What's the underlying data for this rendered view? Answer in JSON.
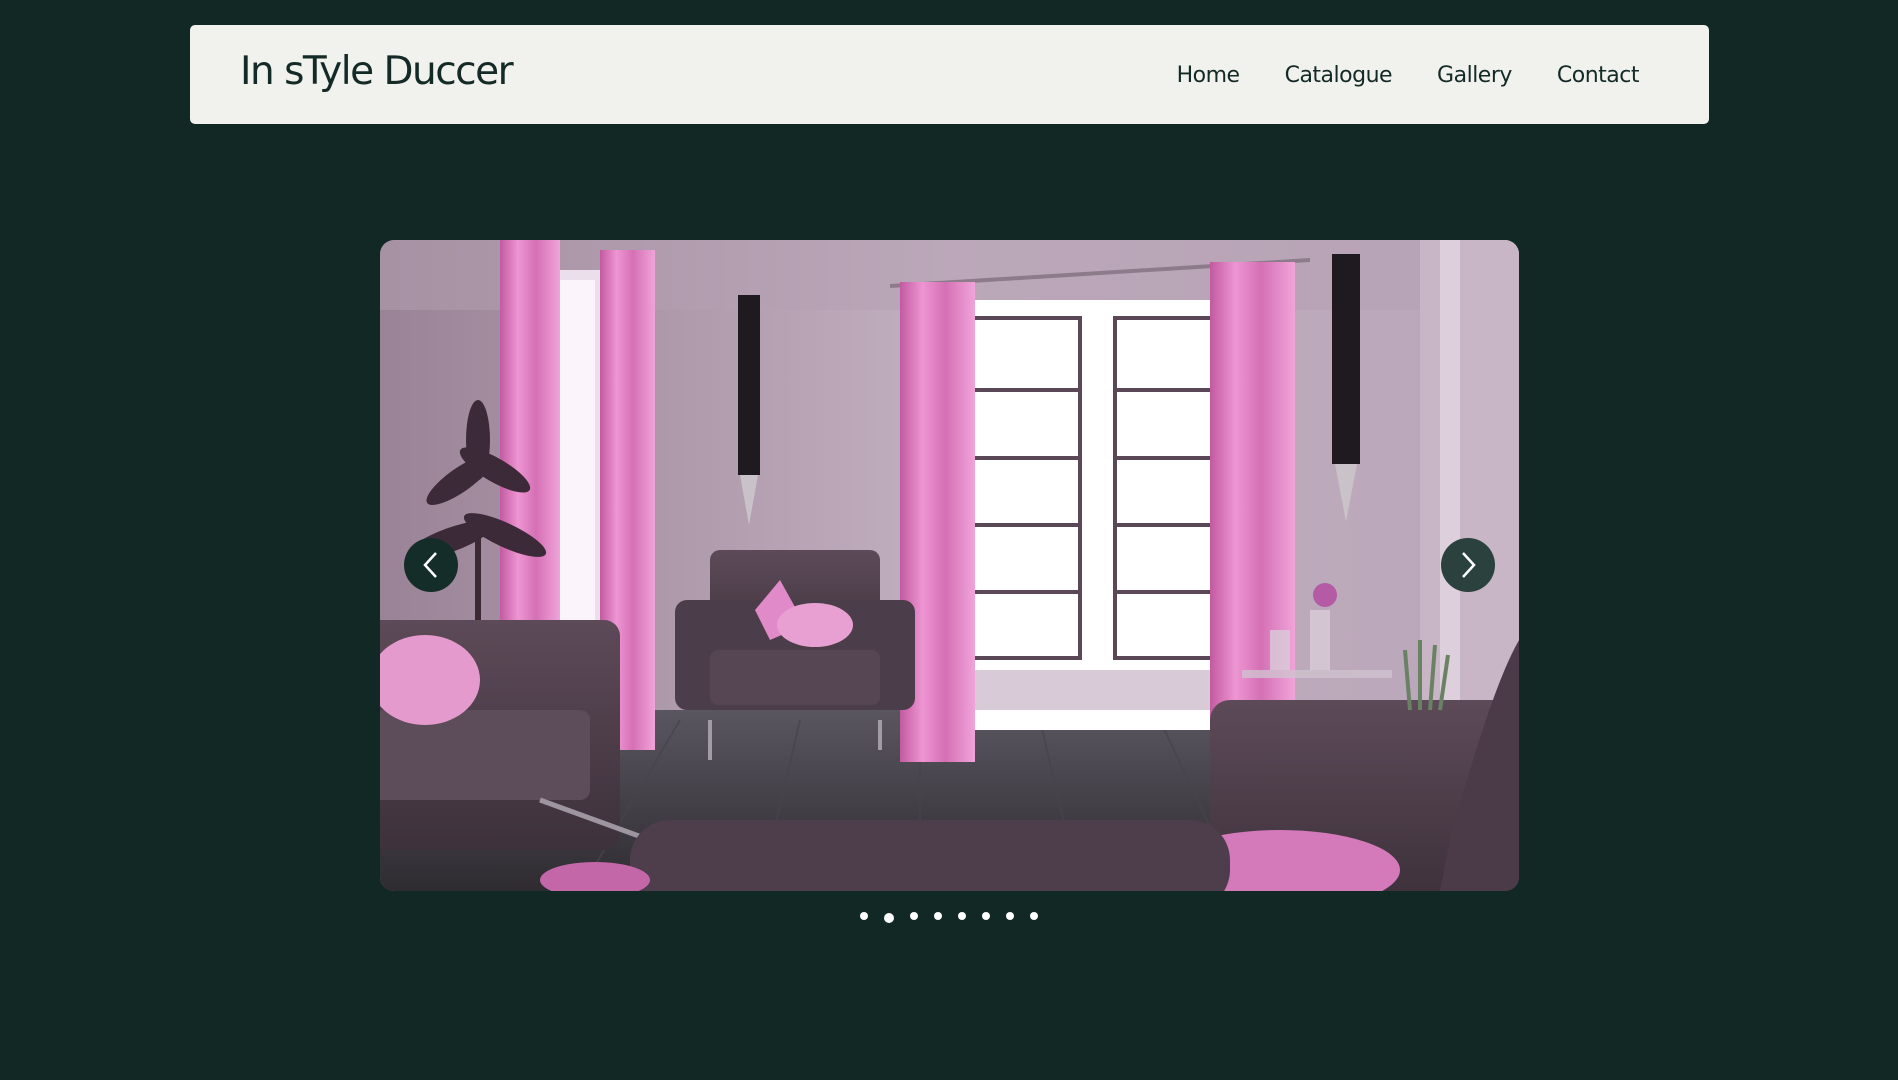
{
  "header": {
    "brand": "In sTyle Duccer",
    "nav": [
      {
        "label": "Home"
      },
      {
        "label": "Catalogue"
      },
      {
        "label": "Gallery"
      },
      {
        "label": "Contact"
      }
    ]
  },
  "slider": {
    "image_icon": "living-room-photo",
    "prev_icon": "chevron-left-icon",
    "next_icon": "chevron-right-icon",
    "total_slides": 8,
    "active_slide": 2
  },
  "colors": {
    "background": "#112825",
    "header_bg": "#f1f2ee",
    "text": "#142a27",
    "curtain_pink": "#e27fc4",
    "wall": "#b7a3b5"
  }
}
